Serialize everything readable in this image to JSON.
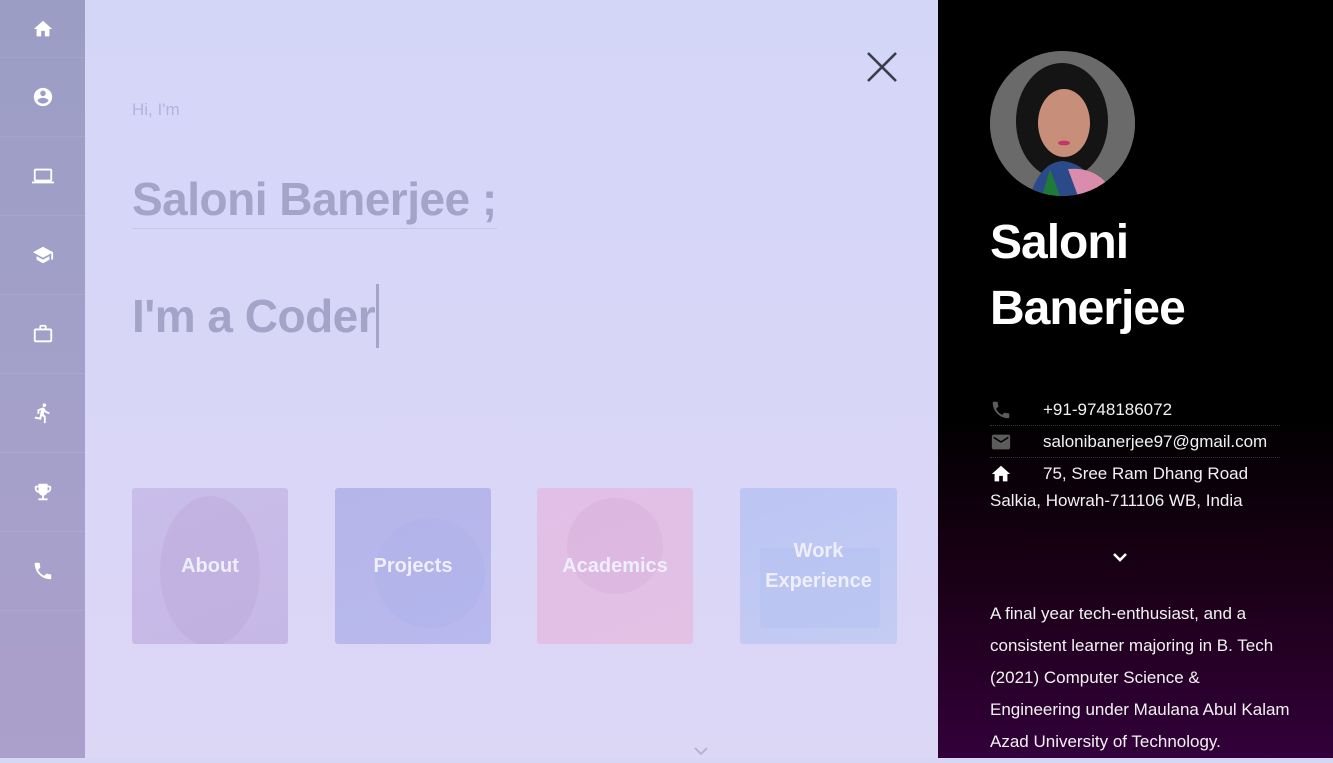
{
  "sidebar": {
    "items": [
      {
        "icon": "home-icon"
      },
      {
        "icon": "account-icon"
      },
      {
        "icon": "laptop-icon"
      },
      {
        "icon": "school-icon"
      },
      {
        "icon": "briefcase-icon"
      },
      {
        "icon": "run-icon"
      },
      {
        "icon": "trophy-icon"
      },
      {
        "icon": "phone-icon"
      }
    ]
  },
  "hero": {
    "greeting": "Hi, I'm",
    "name": "Saloni Banerjee ;",
    "role": "I'm a Coder"
  },
  "tiles": [
    {
      "label": "About"
    },
    {
      "label": "Projects"
    },
    {
      "label": "Academics"
    },
    {
      "label": "Work Experience"
    }
  ],
  "profile": {
    "first_name": "Saloni",
    "last_name": "Banerjee",
    "phone": "+91-9748186072",
    "email": "salonibanerjee97@gmail.com",
    "address_line1": "75, Sree Ram Dhang Road",
    "address_line2": "Salkia, Howrah-711106 WB, India",
    "bio": "A final year tech-enthusiast, and a consistent learner majoring in B. Tech (2021) Computer Science & Engineering under Maulana Abul Kalam Azad University of Technology."
  },
  "colors": {
    "panel_bg": "#000000",
    "main_bg": "#d8d6f5",
    "heading_text": "#a4a3c8"
  }
}
